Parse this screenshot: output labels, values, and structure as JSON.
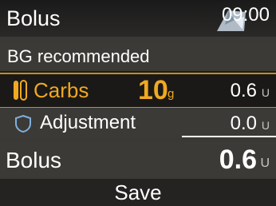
{
  "header": {
    "title": "Bolus",
    "time": "09:00"
  },
  "bg_row": {
    "label": "BG recommended"
  },
  "carbs_row": {
    "label": "Carbs",
    "value": "10",
    "value_unit": "g",
    "dose": "0.6",
    "dose_unit": "U",
    "icon": "carbs-icon"
  },
  "adjustment_row": {
    "label": "Adjustment",
    "dose": "0.0",
    "dose_unit": "U",
    "icon": "shield-icon"
  },
  "bolus_row": {
    "label": "Bolus",
    "dose": "0.6",
    "dose_unit": "U"
  },
  "save": {
    "label": "Save"
  },
  "colors": {
    "accent": "#f0a822",
    "background": "#3b3a36",
    "highlight_border": "#c98e14"
  }
}
